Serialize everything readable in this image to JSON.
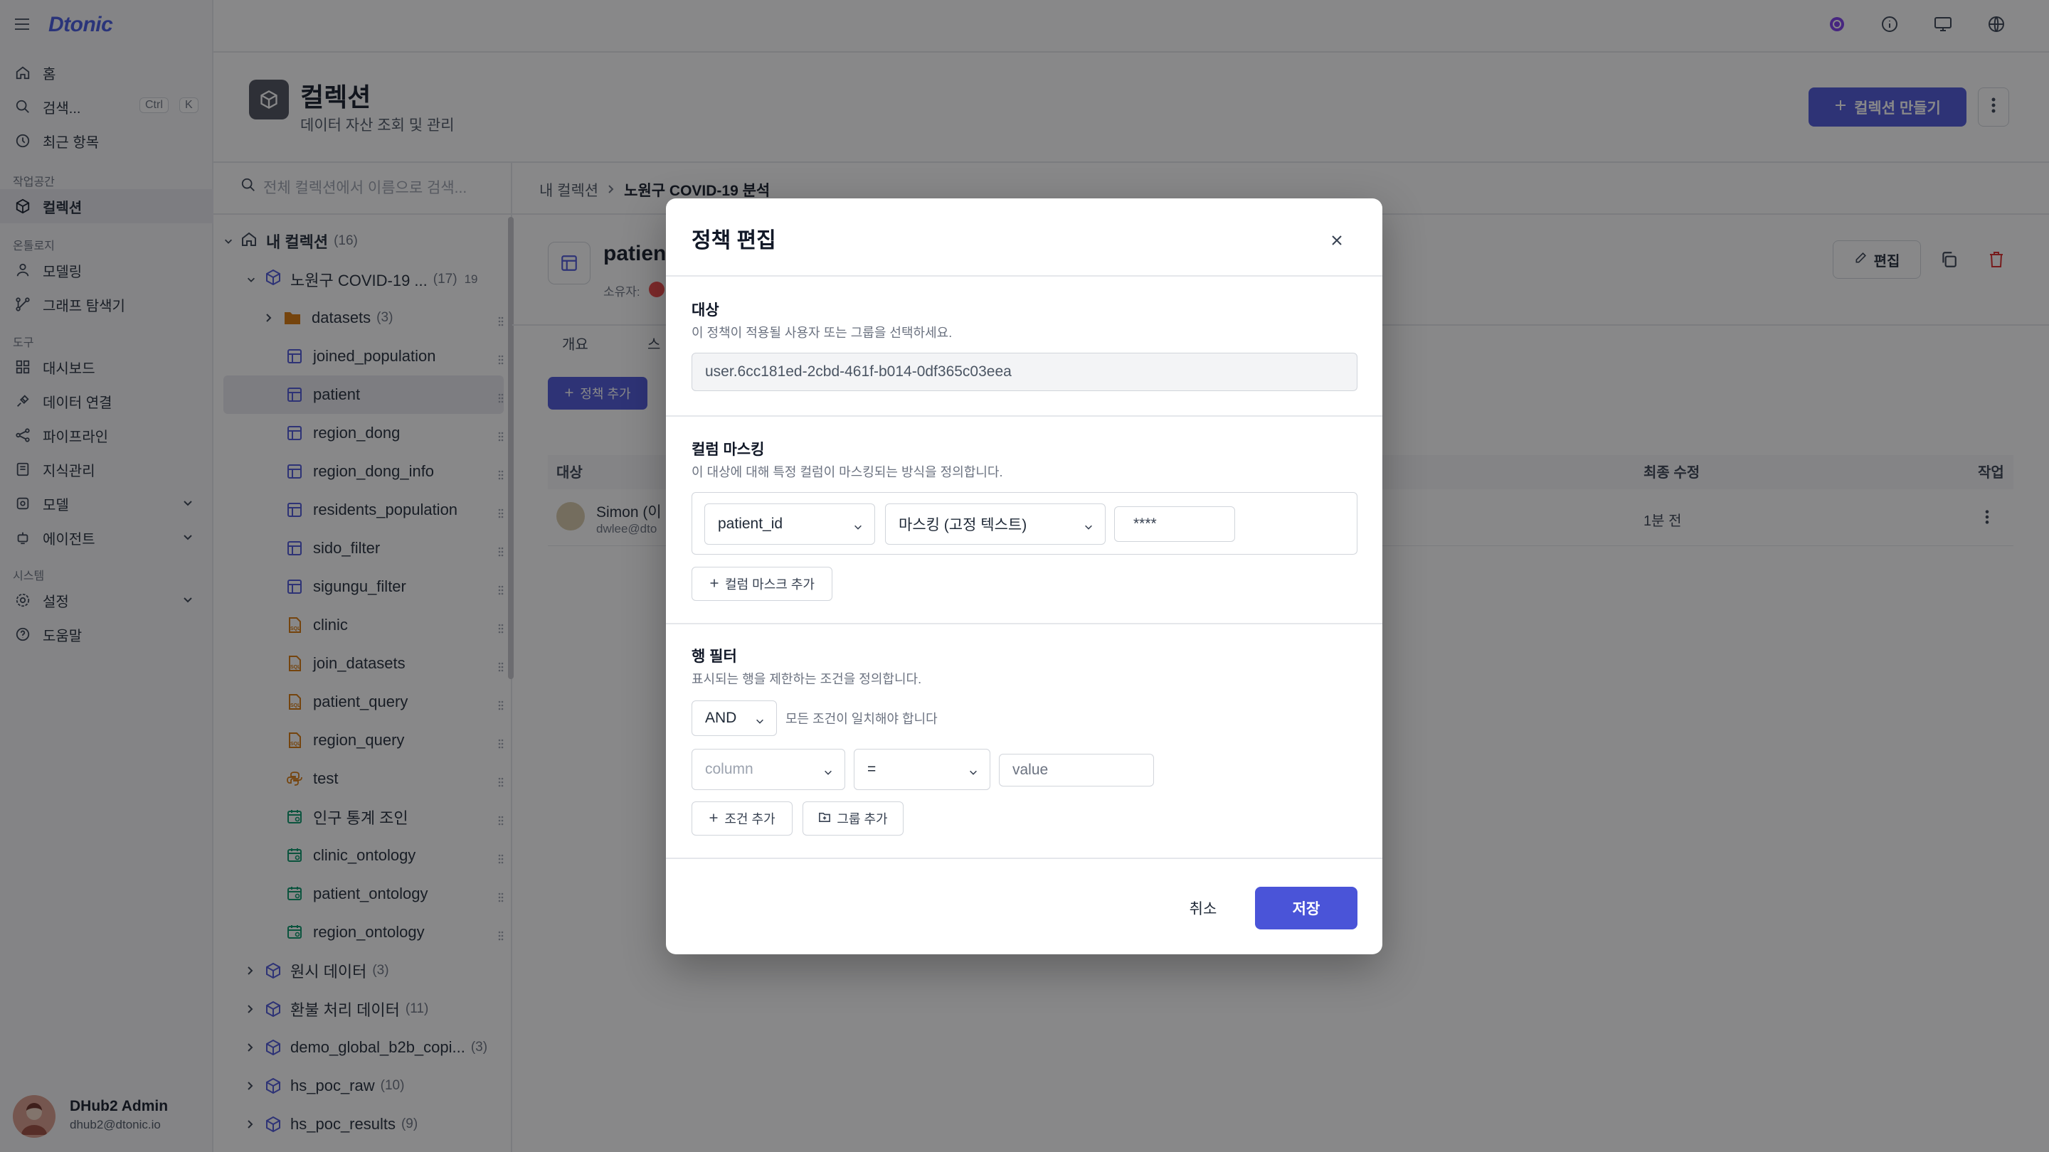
{
  "app": {
    "logo": "Dtonic"
  },
  "sidebar": {
    "home": "홈",
    "search": "검색...",
    "search_kbd_1": "Ctrl",
    "search_kbd_2": "K",
    "recent": "최근 항목",
    "workspace_label": "작업공간",
    "collection": "컬렉션",
    "ontology_label": "온톨로지",
    "modeling": "모델링",
    "graph_explorer": "그래프 탐색기",
    "tools_label": "도구",
    "dashboard": "대시보드",
    "data_connection": "데이터 연결",
    "pipeline": "파이프라인",
    "knowledge": "지식관리",
    "model": "모델",
    "agent": "에이전트",
    "system_label": "시스템",
    "settings": "설정",
    "help": "도움말",
    "user_name": "DHub2 Admin",
    "user_email": "dhub2@dtonic.io"
  },
  "header": {
    "title": "컬렉션",
    "subtitle": "데이터 자산 조회 및 관리",
    "create_button": "컬렉션 만들기"
  },
  "tree": {
    "search_placeholder": "전체 컬렉션에서 이름으로 검색...",
    "root": {
      "label": "내 컬렉션",
      "count": "(16)"
    },
    "collection": {
      "label": "노원구 COVID-19 ...",
      "count": "(17)",
      "extra": "19"
    },
    "items": [
      {
        "label": "datasets",
        "count": "(3)",
        "icon": "folder-icon"
      },
      {
        "label": "joined_population",
        "icon": "table-icon"
      },
      {
        "label": "patient",
        "icon": "table-icon"
      },
      {
        "label": "region_dong",
        "icon": "table-icon"
      },
      {
        "label": "region_dong_info",
        "icon": "table-icon"
      },
      {
        "label": "residents_population",
        "icon": "table-icon"
      },
      {
        "label": "sido_filter",
        "icon": "table-icon"
      },
      {
        "label": "sigungu_filter",
        "icon": "table-icon"
      },
      {
        "label": "clinic",
        "icon": "sql-icon"
      },
      {
        "label": "join_datasets",
        "icon": "sql-icon"
      },
      {
        "label": "patient_query",
        "icon": "sql-icon"
      },
      {
        "label": "region_query",
        "icon": "sql-icon"
      },
      {
        "label": "test",
        "icon": "python-icon"
      },
      {
        "label": "인구 통계 조인",
        "icon": "ontology-icon"
      },
      {
        "label": "clinic_ontology",
        "icon": "ontology-icon"
      },
      {
        "label": "patient_ontology",
        "icon": "ontology-icon"
      },
      {
        "label": "region_ontology",
        "icon": "ontology-icon"
      }
    ],
    "other_collections": [
      {
        "label": "원시 데이터",
        "count": "(3)"
      },
      {
        "label": "환불 처리 데이터",
        "count": "(11)"
      },
      {
        "label": "demo_global_b2b_copi...",
        "count": "(3)"
      },
      {
        "label": "hs_poc_raw",
        "count": "(10)"
      },
      {
        "label": "hs_poc_results",
        "count": "(9)"
      }
    ]
  },
  "main": {
    "breadcrumb_root": "내 컬렉션",
    "breadcrumb_current": "노원구 COVID-19 분석",
    "asset_title": "patient",
    "owner_label": "소유자:",
    "edit_button": "편집",
    "tab_overview": "개요",
    "tab_schema": "스",
    "add_policy": "정책 추가",
    "col_target": "대상",
    "col_modified": "최종 수정",
    "col_action": "작업",
    "row_user": "Simon (이",
    "row_email": "dwlee@dto",
    "row_modified": "1분 전"
  },
  "modal": {
    "title": "정책 편집",
    "target_heading": "대상",
    "target_desc": "이 정책이 적용될 사용자 또는 그룹을 선택하세요.",
    "target_value": "user.6cc181ed-2cbd-461f-b014-0df365c03eea",
    "masking_heading": "컬럼 마스킹",
    "masking_desc": "이 대상에 대해 특정 컬럼이 마스킹되는 방식을 정의합니다.",
    "mask_column": "patient_id",
    "mask_type": "마스킹 (고정 텍스트)",
    "mask_value": "****",
    "add_mask": "컬럼 마스크 추가",
    "row_filter_heading": "행 필터",
    "row_filter_desc": "표시되는 행을 제한하는 조건을 정의합니다.",
    "logic_value": "AND",
    "logic_hint": "모든 조건이 일치해야 합니다",
    "cond_column_placeholder": "column",
    "cond_operator": "=",
    "cond_value_placeholder": "value",
    "add_condition": "조건 추가",
    "add_group": "그룹 추가",
    "cancel": "취소",
    "save": "저장"
  },
  "colors": {
    "accent": "#4a54d8",
    "logo": "#4356e0",
    "danger": "#dc2626"
  }
}
